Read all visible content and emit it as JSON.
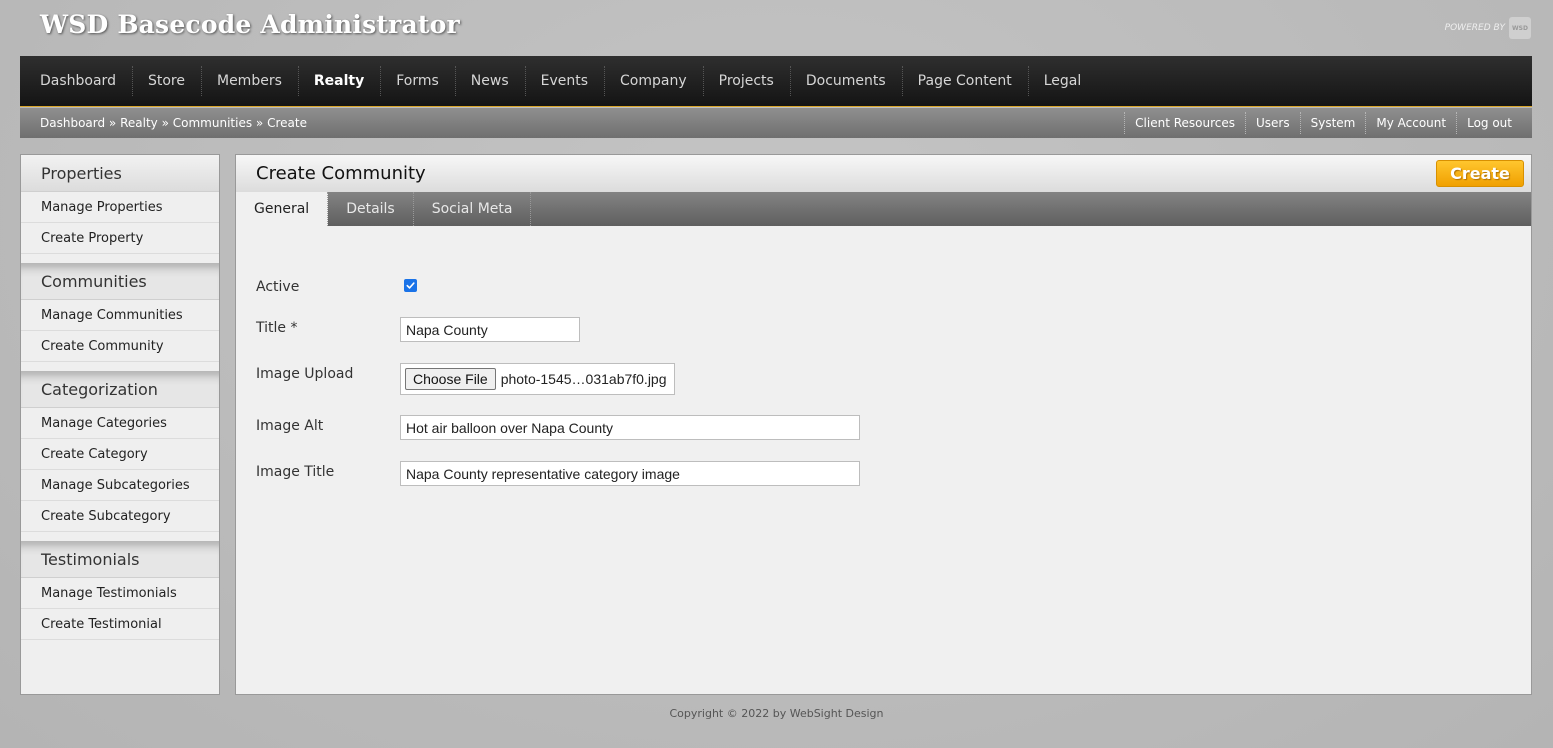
{
  "header": {
    "site_title": "WSD Basecode Administrator",
    "powered_by": "POWERED BY",
    "logo_text": "WSD"
  },
  "main_nav": {
    "items": [
      "Dashboard",
      "Store",
      "Members",
      "Realty",
      "Forms",
      "News",
      "Events",
      "Company",
      "Projects",
      "Documents",
      "Page Content",
      "Legal"
    ],
    "active": "Realty"
  },
  "breadcrumb": {
    "items": [
      "Dashboard",
      "Realty",
      "Communities",
      "Create"
    ],
    "separator": " » "
  },
  "utility_nav": [
    "Client Resources",
    "Users",
    "System",
    "My Account",
    "Log out"
  ],
  "sidebar": {
    "sections": [
      {
        "heading": "Properties",
        "links": [
          "Manage Properties",
          "Create Property"
        ]
      },
      {
        "heading": "Communities",
        "links": [
          "Manage Communities",
          "Create Community"
        ]
      },
      {
        "heading": "Categorization",
        "links": [
          "Manage Categories",
          "Create Category",
          "Manage Subcategories",
          "Create Subcategory"
        ]
      },
      {
        "heading": "Testimonials",
        "links": [
          "Manage Testimonials",
          "Create Testimonial"
        ]
      }
    ]
  },
  "content": {
    "title": "Create Community",
    "create_button": "Create",
    "tabs": [
      "General",
      "Details",
      "Social Meta"
    ],
    "active_tab": "General"
  },
  "form": {
    "active_label": "Active",
    "active_checked": true,
    "title_label": "Title *",
    "title_value": "Napa County",
    "image_upload_label": "Image Upload",
    "choose_file_label": "Choose File",
    "file_name": "photo-1545…031ab7f0.jpg",
    "image_alt_label": "Image Alt",
    "image_alt_value": "Hot air balloon over Napa County",
    "image_title_label": "Image Title",
    "image_title_value": "Napa County representative category image"
  },
  "footer": {
    "copyright": "Copyright © 2022 by WebSight Design"
  },
  "colors": {
    "nav_bg": "#1c1c1c",
    "accent": "#f5a800",
    "checkbox": "#1a73e8"
  }
}
